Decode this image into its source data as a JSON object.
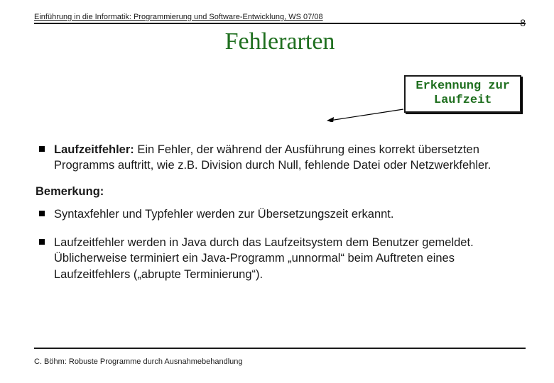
{
  "header": {
    "course": "Einführung in die Informatik: Programmierung und Software-Entwicklung, WS 07/08",
    "page_number": "8"
  },
  "title": "Fehlerarten",
  "callout": {
    "line1": "Erkennung zur",
    "line2": "Laufzeit"
  },
  "bullets": {
    "b1_label": "Laufzeitfehler:",
    "b1_text": " Ein Fehler, der während der Ausführung eines korrekt übersetzten Programms auftritt, wie z.B. Division durch Null, fehlende Datei oder Netzwerkfehler."
  },
  "remark_label": "Bemerkung:",
  "remarks": {
    "r1": "Syntaxfehler und Typfehler werden zur Übersetzungszeit erkannt.",
    "r2": " Laufzeitfehler werden in Java durch das Laufzeitsystem dem Benutzer gemeldet. Üblicherweise terminiert ein Java-Programm „unnormal“ beim Auftreten eines Laufzeitfehlers („abrupte Terminierung“)."
  },
  "footer": "C. Böhm: Robuste Programme durch Ausnahmebehandlung"
}
